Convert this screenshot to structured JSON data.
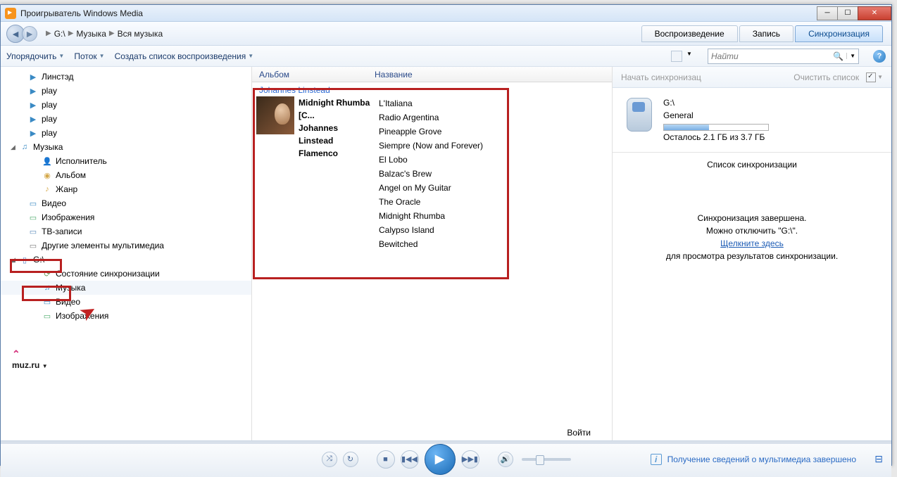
{
  "titlebar": {
    "title": "Проигрыватель Windows Media"
  },
  "breadcrumb": {
    "p1": "G:\\",
    "p2": "Музыка",
    "p3": "Вся музыка"
  },
  "tabs": {
    "play": "Воспроизведение",
    "burn": "Запись",
    "sync": "Синхронизация"
  },
  "toolbar": {
    "organize": "Упорядочить",
    "stream": "Поток",
    "createpl": "Создать список воспроизведения"
  },
  "search": {
    "placeholder": "Найти"
  },
  "sidebar": {
    "linstead": "Линстэд",
    "play1": "play",
    "play2": "play",
    "play3": "play",
    "play4": "play",
    "music": "Музыка",
    "artist": "Исполнитель",
    "album": "Альбом",
    "genre": "Жанр",
    "video": "Видео",
    "pictures": "Изображения",
    "tv": "ТВ-записи",
    "other": "Другие элементы мультимедиа",
    "device": "G:\\",
    "syncstatus": "Состояние синхронизации",
    "dmusic": "Музыка",
    "dvideo": "Видео",
    "dpictures": "Изображения"
  },
  "columns": {
    "album": "Альбом",
    "title": "Название"
  },
  "artist": "Johannes Linstead",
  "albuminfo": {
    "l1": "Midnight Rhumba [C...",
    "l2": "Johannes Linstead",
    "l3": "Flamenco"
  },
  "tracks": [
    "L'Italiana",
    "Radio Argentina",
    "Pineapple Grove",
    "Siempre (Now and Forever)",
    "El Lobo",
    "Balzac's Brew",
    "Angel on My Guitar",
    "The Oracle",
    "Midnight Rhumba",
    "Calypso Island",
    "Bewitched"
  ],
  "login": "Войти",
  "rp": {
    "start": "Начать синхронизац",
    "clear": "Очистить список",
    "devname": "G:\\",
    "devtype": "General",
    "space": "Осталось 2.1 ГБ из 3.7 ГБ",
    "listtitle": "Список синхронизации",
    "done": "Синхронизация завершена.",
    "disconnect": "Можно отключить \"G:\\\".",
    "clickhere": "Щелкните здесь",
    "forresults": "для просмотра результатов синхронизации."
  },
  "player": {
    "mediainfo": "Получение сведений о мультимедиа завершено"
  },
  "muzru": "muz.ru"
}
